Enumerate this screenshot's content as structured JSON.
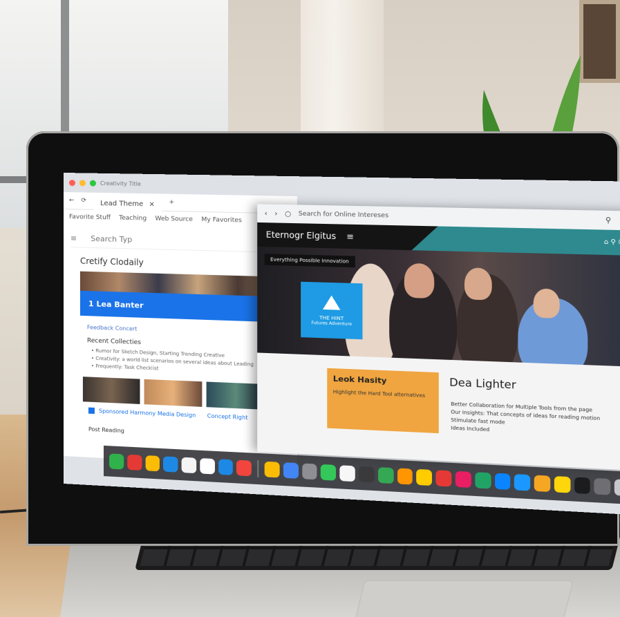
{
  "back_window": {
    "tab_title": "Lead Theme",
    "window_title": "Creativity Title",
    "bookmarks": [
      "Favorite Stuff",
      "Teaching",
      "Web Source",
      "My Favorites"
    ],
    "search_placeholder": "Search Typ",
    "section_title": "Cretify Clodaily",
    "blue_bar": "1 Lea Banter",
    "small_link": "Feedback Concert",
    "subheading": "Recent Collecties",
    "bullets": [
      "Rumor for Sketch Design, Starting Trending Creative",
      "Creativity: a world list scenarios on several ideas about Leading",
      "Frequently: Task Checklist"
    ],
    "link_row": "Sponsored Harmony Media Design",
    "link_row_2": "Concept Right",
    "footer_label": "Post Reading"
  },
  "front_window": {
    "url": "Search for Online Intereses",
    "site_name": "Eternogr Elgitus",
    "hero_button": "Everything Possible Innovation",
    "logo_text": "THE HINT",
    "logo_sub": "Futures Adventure",
    "promo_title": "Leok Hasity",
    "promo_text": "Highlight the Hard Tool alternatives",
    "aside_title": "Dea Lighter",
    "aside_lines": [
      "Better Collaboration for Multiple Tools from the page",
      "Our Insights: That concepts of ideas for reading motion",
      "Stimulate fast mode",
      "Ideas Included"
    ]
  },
  "dock": {
    "apps": [
      "finder-icon",
      "youtube-icon",
      "chrome-icon",
      "safari-icon",
      "notes-icon",
      "calendar-icon",
      "maps-icon",
      "music-icon",
      "photos-icon",
      "mail-icon",
      "settings-icon",
      "messages-icon",
      "files-icon",
      "grid-icon",
      "android-icon",
      "app-icon",
      "reminder-icon",
      "paint-icon",
      "flag-icon",
      "excel-icon",
      "store-icon",
      "prime-icon",
      "colors-icon",
      "time-icon",
      "terminal-icon",
      "folder-icon",
      "trash-icon"
    ]
  }
}
